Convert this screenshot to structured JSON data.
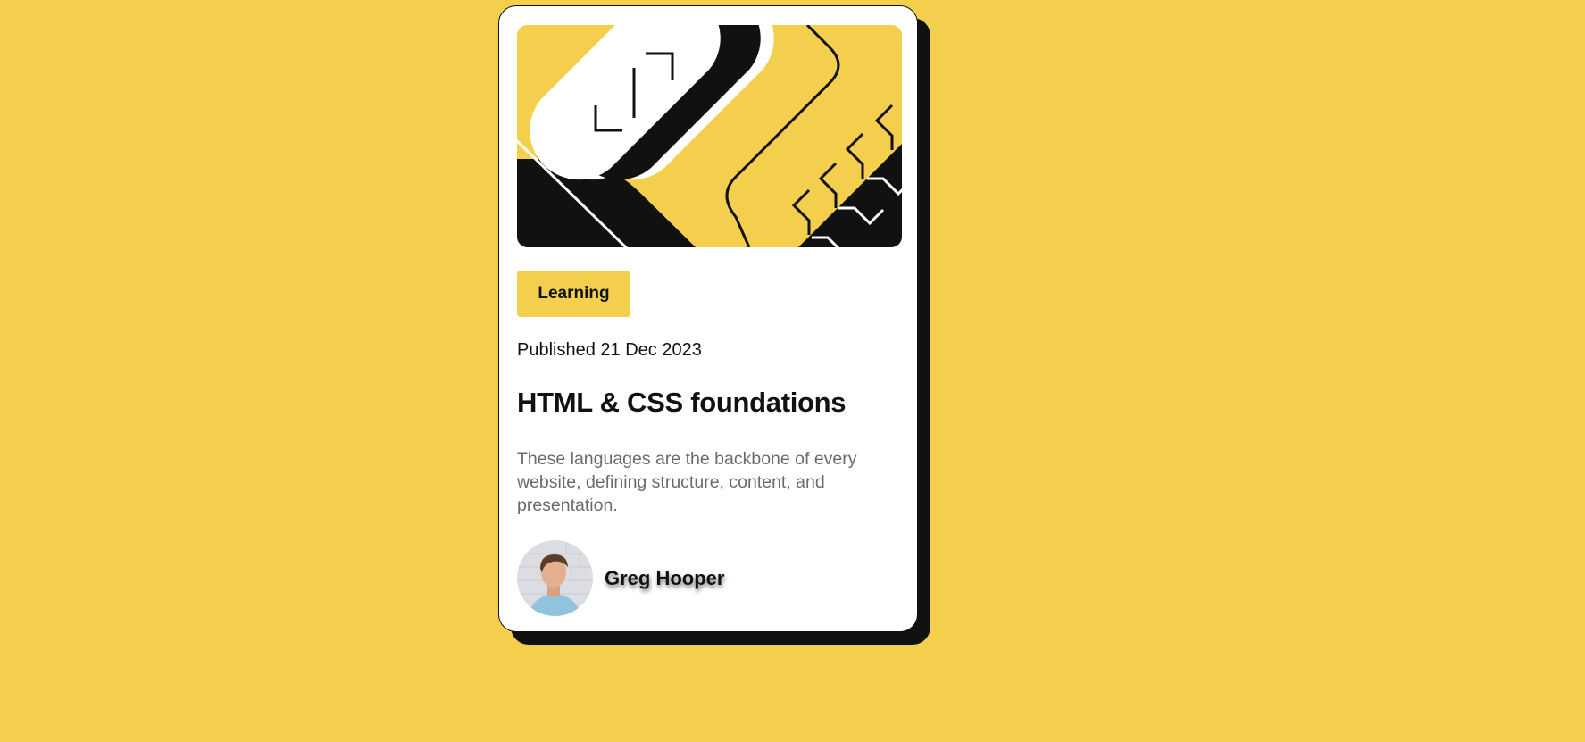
{
  "card": {
    "category_tag": "Learning",
    "published": "Published 21 Dec 2023",
    "title": "HTML & CSS foundations",
    "description": "These languages are the backbone of every website, defining structure, content, and presentation.",
    "author": {
      "name": "Greg Hooper",
      "avatar_icon": "person-avatar-icon"
    },
    "hero_icon": "abstract-illustration-icon"
  },
  "colors": {
    "background": "#F4CF4E",
    "card": "#FFFFFF",
    "ink": "#111111",
    "muted_text": "#6B6B6B"
  }
}
